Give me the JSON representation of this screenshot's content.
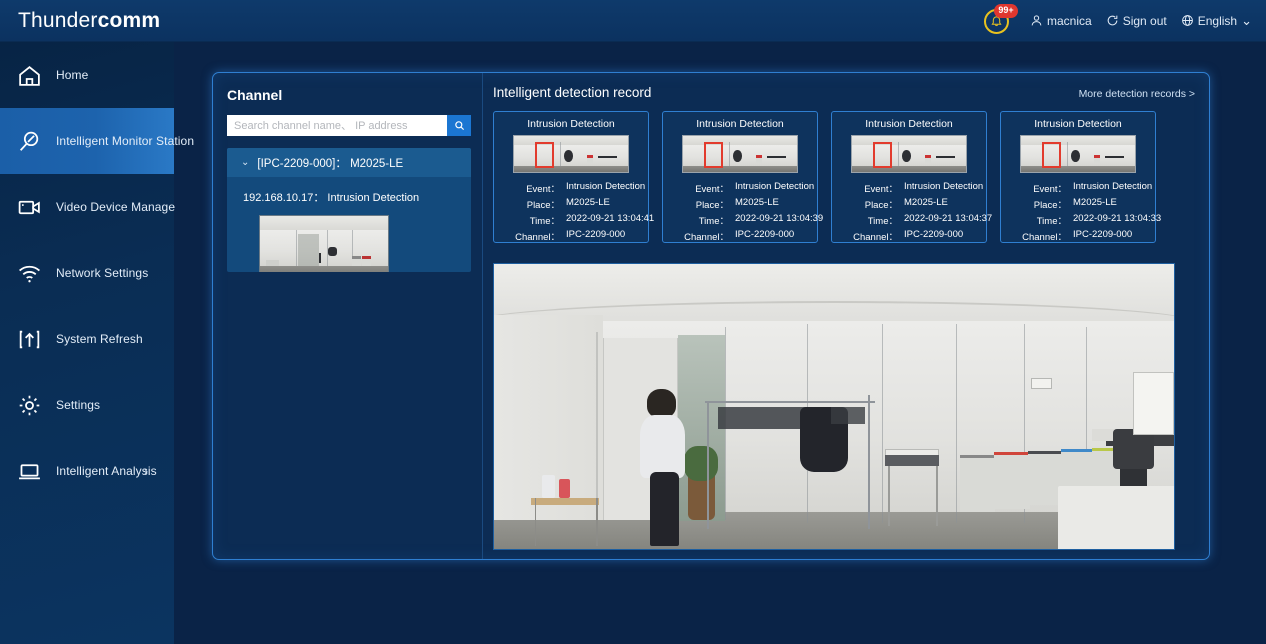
{
  "header": {
    "logo_thin": "Thunder",
    "logo_bold": "comm",
    "notification": {
      "icon": "bell-icon",
      "badge": "99+"
    },
    "user": {
      "icon": "user-icon",
      "label": "macnica"
    },
    "sign_out": {
      "icon": "signout-icon",
      "label": "Sign out"
    },
    "language": {
      "icon": "globe-icon",
      "label": "English",
      "chevron": "⌄"
    }
  },
  "sidebar": {
    "items": [
      {
        "label": "Home",
        "icon": "home-icon",
        "active": false
      },
      {
        "label": "Intelligent Monitor Station",
        "icon": "magnifier-slash-icon",
        "active": true
      },
      {
        "label": "Video Device Manage",
        "icon": "video-camera-icon",
        "active": false
      },
      {
        "label": "Network Settings",
        "icon": "wifi-icon",
        "active": false
      },
      {
        "label": "System Refresh",
        "icon": "upload-box-icon",
        "active": false
      },
      {
        "label": "Settings",
        "icon": "gear-icon",
        "active": false
      },
      {
        "label": "Intelligent Analysis",
        "icon": "laptop-icon",
        "active": false,
        "chevron": "›"
      }
    ]
  },
  "channel_panel": {
    "title": "Channel",
    "search_placeholder": "Search channel name、 IP address",
    "search_value": "",
    "search_icon": "search-icon",
    "tree": {
      "caret": "⌄",
      "node_label": "[IPC-2209-000]： M2025-LE",
      "leaf_label": "192.168.10.17： Intrusion Detection",
      "thumbnail_alt": "channel-preview"
    }
  },
  "record_panel": {
    "title": "Intelligent detection record",
    "more_link": "More detection records >",
    "field_labels": {
      "event": "Event：",
      "place": "Place：",
      "time": "Time：",
      "channel": "Channel："
    },
    "cards": [
      {
        "title": "Intrusion Detection",
        "event": "Intrusion Detection",
        "place": "M2025-LE",
        "time": "2022-09-21 13:04:41",
        "channel": "IPC-2209-000"
      },
      {
        "title": "Intrusion Detection",
        "event": "Intrusion Detection",
        "place": "M2025-LE",
        "time": "2022-09-21 13:04:39",
        "channel": "IPC-2209-000"
      },
      {
        "title": "Intrusion Detection",
        "event": "Intrusion Detection",
        "place": "M2025-LE",
        "time": "2022-09-21 13:04:37",
        "channel": "IPC-2209-000"
      },
      {
        "title": "Intrusion Detection",
        "event": "Intrusion Detection",
        "place": "M2025-LE",
        "time": "2022-09-21 13:04:33",
        "channel": "IPC-2209-000"
      }
    ],
    "video_alt": "live-video-feed"
  },
  "colors": {
    "page_background": "#0a2347",
    "header_background": "#0d3563",
    "accent_blue": "#2f7fd1",
    "active_nav": "#1d63ad",
    "badge_red": "#e0372f",
    "notification_yellow": "#e8c21f",
    "bbox_red": "#e23b2d"
  }
}
